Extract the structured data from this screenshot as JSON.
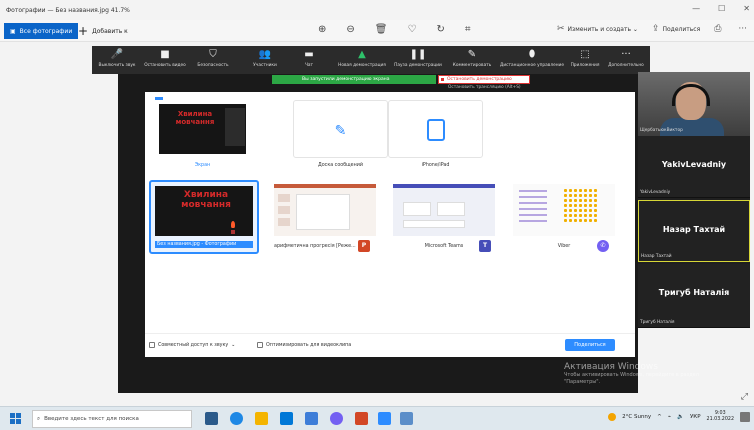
{
  "window": {
    "title": "Фотографии — Без названия.jpg  41.7%",
    "controls": [
      "—",
      "☐",
      "✕"
    ]
  },
  "toolbar": {
    "all_photos": "Все фотографии",
    "add": "Добавить к",
    "center_icons": [
      "zoom-in-icon",
      "zoom-out-icon",
      "delete-icon",
      "heart-icon",
      "rotate-icon",
      "crop-icon"
    ],
    "edit_create": "Изменить и создать",
    "share": "Поделиться"
  },
  "zoom_bar": {
    "items": [
      {
        "label": "Выключить звук",
        "icon": "mic-icon",
        "glyph": "🎤"
      },
      {
        "label": "Остановить видео",
        "icon": "camera-icon",
        "glyph": "■"
      },
      {
        "label": "Безопасность",
        "icon": "shield-icon",
        "glyph": "⛉"
      },
      {
        "label": "Участники",
        "icon": "participants-icon",
        "glyph": "👥"
      },
      {
        "label": "Чат",
        "icon": "chat-icon",
        "glyph": "▬"
      },
      {
        "label": "Новая демонстрация",
        "icon": "share-icon",
        "glyph": "▲"
      },
      {
        "label": "Пауза демонстрации",
        "icon": "pause-icon",
        "glyph": "❚❚"
      },
      {
        "label": "Комментировать",
        "icon": "pen-icon",
        "glyph": "✎"
      },
      {
        "label": "Дистанционное управление",
        "icon": "remote-icon",
        "glyph": "⬮"
      },
      {
        "label": "Приложения",
        "icon": "apps-icon",
        "glyph": "⬚"
      },
      {
        "label": "Дополнительно",
        "icon": "more-icon",
        "glyph": "···"
      }
    ]
  },
  "banner": {
    "sharing": "Вы запустили демонстрацию экрана",
    "stop_demo": "Остановить демонстрацию",
    "stop_share": "Остановить трансляцию (Alt+S)"
  },
  "share_dialog": {
    "tiles": [
      {
        "label": "Экран"
      },
      {
        "label": "Доска сообщений"
      },
      {
        "label": "iPhone/iPad"
      },
      {
        "label": "Без названия.jpg - Фотографии"
      },
      {
        "label": "арифметична прогресія [Реже..."
      },
      {
        "label": "Microsoft Teams"
      },
      {
        "label": "Viber"
      }
    ],
    "thumb_text": "Хвилина мовчання",
    "share_sound": "Совместный доступ к звуку",
    "optimize_video": "Оптимизировать для видеоклипа",
    "share_button": "Поделиться"
  },
  "participants": [
    {
      "name": "",
      "caption": "ЩербатьюкВиктор",
      "video": true
    },
    {
      "name": "YakivLevadniy",
      "caption": "YakivLevadniy"
    },
    {
      "name": "Назар Тахтай",
      "caption": "Назар Тахтай",
      "active": true
    },
    {
      "name": "Тригуб Наталія",
      "caption": "Тригуб Наталія"
    }
  ],
  "watermark": {
    "title": "Активация Windows",
    "subtitle": "Чтобы активировать Windows, перейдите в раздел \"Параметры\"."
  },
  "taskbar": {
    "search_placeholder": "Введите здесь текст для поиска",
    "weather": "2°C Sunny",
    "lang": "УКР",
    "time": "9:03",
    "date": "21.03.2022"
  },
  "colors": {
    "accent": "#2d8cff",
    "zoom_bg": "#1a1a1a",
    "share_green": "#2ca745",
    "stop_red": "#dd3333",
    "photos_blue": "#0a64c8"
  }
}
